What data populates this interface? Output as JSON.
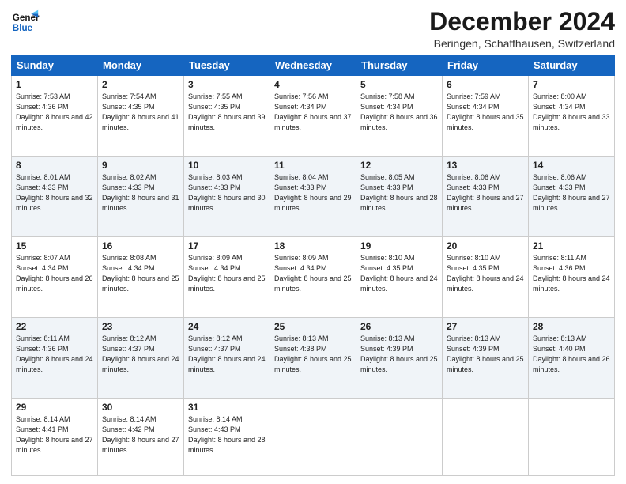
{
  "header": {
    "logo_line1": "General",
    "logo_line2": "Blue",
    "title": "December 2024",
    "subtitle": "Beringen, Schaffhausen, Switzerland"
  },
  "calendar": {
    "days_of_week": [
      "Sunday",
      "Monday",
      "Tuesday",
      "Wednesday",
      "Thursday",
      "Friday",
      "Saturday"
    ],
    "weeks": [
      [
        {
          "day": "1",
          "sunrise": "7:53 AM",
          "sunset": "4:36 PM",
          "daylight": "8 hours and 42 minutes."
        },
        {
          "day": "2",
          "sunrise": "7:54 AM",
          "sunset": "4:35 PM",
          "daylight": "8 hours and 41 minutes."
        },
        {
          "day": "3",
          "sunrise": "7:55 AM",
          "sunset": "4:35 PM",
          "daylight": "8 hours and 39 minutes."
        },
        {
          "day": "4",
          "sunrise": "7:56 AM",
          "sunset": "4:34 PM",
          "daylight": "8 hours and 37 minutes."
        },
        {
          "day": "5",
          "sunrise": "7:58 AM",
          "sunset": "4:34 PM",
          "daylight": "8 hours and 36 minutes."
        },
        {
          "day": "6",
          "sunrise": "7:59 AM",
          "sunset": "4:34 PM",
          "daylight": "8 hours and 35 minutes."
        },
        {
          "day": "7",
          "sunrise": "8:00 AM",
          "sunset": "4:34 PM",
          "daylight": "8 hours and 33 minutes."
        }
      ],
      [
        {
          "day": "8",
          "sunrise": "8:01 AM",
          "sunset": "4:33 PM",
          "daylight": "8 hours and 32 minutes."
        },
        {
          "day": "9",
          "sunrise": "8:02 AM",
          "sunset": "4:33 PM",
          "daylight": "8 hours and 31 minutes."
        },
        {
          "day": "10",
          "sunrise": "8:03 AM",
          "sunset": "4:33 PM",
          "daylight": "8 hours and 30 minutes."
        },
        {
          "day": "11",
          "sunrise": "8:04 AM",
          "sunset": "4:33 PM",
          "daylight": "8 hours and 29 minutes."
        },
        {
          "day": "12",
          "sunrise": "8:05 AM",
          "sunset": "4:33 PM",
          "daylight": "8 hours and 28 minutes."
        },
        {
          "day": "13",
          "sunrise": "8:06 AM",
          "sunset": "4:33 PM",
          "daylight": "8 hours and 27 minutes."
        },
        {
          "day": "14",
          "sunrise": "8:06 AM",
          "sunset": "4:33 PM",
          "daylight": "8 hours and 27 minutes."
        }
      ],
      [
        {
          "day": "15",
          "sunrise": "8:07 AM",
          "sunset": "4:34 PM",
          "daylight": "8 hours and 26 minutes."
        },
        {
          "day": "16",
          "sunrise": "8:08 AM",
          "sunset": "4:34 PM",
          "daylight": "8 hours and 25 minutes."
        },
        {
          "day": "17",
          "sunrise": "8:09 AM",
          "sunset": "4:34 PM",
          "daylight": "8 hours and 25 minutes."
        },
        {
          "day": "18",
          "sunrise": "8:09 AM",
          "sunset": "4:34 PM",
          "daylight": "8 hours and 25 minutes."
        },
        {
          "day": "19",
          "sunrise": "8:10 AM",
          "sunset": "4:35 PM",
          "daylight": "8 hours and 24 minutes."
        },
        {
          "day": "20",
          "sunrise": "8:10 AM",
          "sunset": "4:35 PM",
          "daylight": "8 hours and 24 minutes."
        },
        {
          "day": "21",
          "sunrise": "8:11 AM",
          "sunset": "4:36 PM",
          "daylight": "8 hours and 24 minutes."
        }
      ],
      [
        {
          "day": "22",
          "sunrise": "8:11 AM",
          "sunset": "4:36 PM",
          "daylight": "8 hours and 24 minutes."
        },
        {
          "day": "23",
          "sunrise": "8:12 AM",
          "sunset": "4:37 PM",
          "daylight": "8 hours and 24 minutes."
        },
        {
          "day": "24",
          "sunrise": "8:12 AM",
          "sunset": "4:37 PM",
          "daylight": "8 hours and 24 minutes."
        },
        {
          "day": "25",
          "sunrise": "8:13 AM",
          "sunset": "4:38 PM",
          "daylight": "8 hours and 25 minutes."
        },
        {
          "day": "26",
          "sunrise": "8:13 AM",
          "sunset": "4:39 PM",
          "daylight": "8 hours and 25 minutes."
        },
        {
          "day": "27",
          "sunrise": "8:13 AM",
          "sunset": "4:39 PM",
          "daylight": "8 hours and 25 minutes."
        },
        {
          "day": "28",
          "sunrise": "8:13 AM",
          "sunset": "4:40 PM",
          "daylight": "8 hours and 26 minutes."
        }
      ],
      [
        {
          "day": "29",
          "sunrise": "8:14 AM",
          "sunset": "4:41 PM",
          "daylight": "8 hours and 27 minutes."
        },
        {
          "day": "30",
          "sunrise": "8:14 AM",
          "sunset": "4:42 PM",
          "daylight": "8 hours and 27 minutes."
        },
        {
          "day": "31",
          "sunrise": "8:14 AM",
          "sunset": "4:43 PM",
          "daylight": "8 hours and 28 minutes."
        },
        null,
        null,
        null,
        null
      ]
    ]
  }
}
